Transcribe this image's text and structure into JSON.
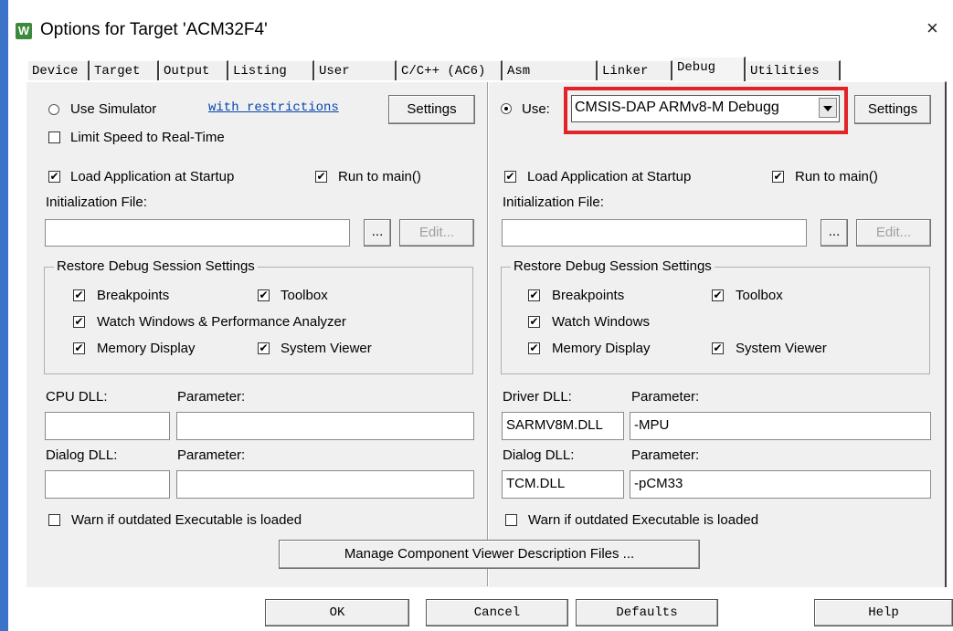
{
  "window": {
    "title": "Options for Target 'ACM32F4'",
    "icon_letter": "W",
    "close": "×"
  },
  "tabs": [
    "Device",
    "Target",
    "Output",
    "Listing",
    "User",
    "C/C++ (AC6)",
    "Asm",
    "Linker",
    "Debug",
    "Utilities"
  ],
  "active_tab": "Debug",
  "left": {
    "use_simulator": "Use Simulator",
    "with_restrictions": "with restrictions",
    "settings": "Settings",
    "limit_speed": "Limit Speed to Real-Time",
    "load_app": "Load Application at Startup",
    "run_to_main": "Run to main()",
    "init_file": "Initialization File:",
    "browse": "...",
    "edit": "Edit...",
    "restore_title": "Restore Debug Session Settings",
    "breakpoints": "Breakpoints",
    "toolbox": "Toolbox",
    "watch": "Watch Windows & Performance Analyzer",
    "memory": "Memory Display",
    "system_viewer": "System Viewer",
    "cpu_dll": "CPU DLL:",
    "parameter1": "Parameter:",
    "dialog_dll": "Dialog DLL:",
    "parameter2": "Parameter:",
    "cpu_dll_value": "",
    "cpu_param_value": "",
    "dialog_dll_value": "",
    "dialog_param_value": "",
    "warn": "Warn if outdated Executable is loaded"
  },
  "right": {
    "use": "Use:",
    "debugger": "CMSIS-DAP ARMv8-M Debugg",
    "settings": "Settings",
    "load_app": "Load Application at Startup",
    "run_to_main": "Run to main()",
    "init_file": "Initialization File:",
    "browse": "...",
    "edit": "Edit...",
    "restore_title": "Restore Debug Session Settings",
    "breakpoints": "Breakpoints",
    "toolbox": "Toolbox",
    "watch": "Watch Windows",
    "memory": "Memory Display",
    "system_viewer": "System Viewer",
    "driver_dll": "Driver DLL:",
    "parameter1": "Parameter:",
    "dialog_dll": "Dialog DLL:",
    "parameter2": "Parameter:",
    "driver_dll_value": "SARMV8M.DLL",
    "driver_param_value": "-MPU",
    "dialog_dll_value": "TCM.DLL",
    "dialog_param_value": "-pCM33",
    "warn": "Warn if outdated Executable is loaded"
  },
  "manage_btn": "Manage Component Viewer Description Files ...",
  "footer": {
    "ok": "OK",
    "cancel": "Cancel",
    "defaults": "Defaults",
    "help": "Help"
  },
  "check_mark": "✔",
  "colors": {
    "highlight": "#e0242a",
    "accent": "#3a73c8",
    "link": "#0645ad"
  }
}
